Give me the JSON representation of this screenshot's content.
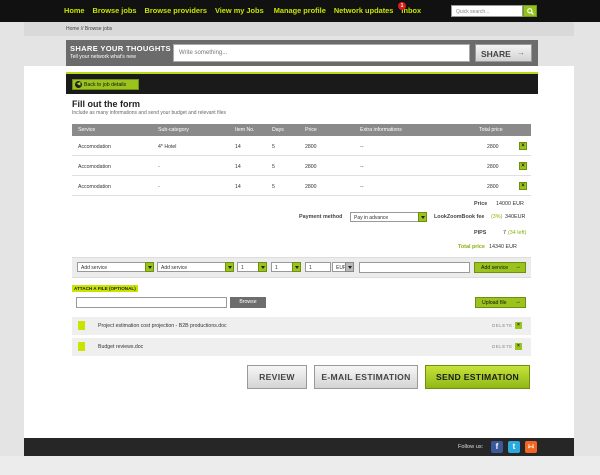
{
  "nav": {
    "items": [
      "Home",
      "Browse jobs",
      "Browse providers",
      "View my Jobs",
      "Manage profile",
      "Network updates",
      "Inbox"
    ],
    "inbox_badge": "1",
    "search_placeholder": "Quick search..."
  },
  "breadcrumb": "Home //  Browse jobs",
  "share": {
    "title": "SHARE YOUR THOUGHTS",
    "subtitle": "Tell your network what's new",
    "placeholder": "Write something...",
    "button": "SHARE"
  },
  "back_button": "Back to job details",
  "form": {
    "title": "Fill out the form",
    "subtitle": "Include as many informations and send your budget and relevant files"
  },
  "table": {
    "headers": [
      "Service",
      "Sub-category",
      "Item No.",
      "Days",
      "Price",
      "Extra informations",
      "Total price"
    ],
    "rows": [
      [
        "Accomodation",
        "4* Hotel",
        "14",
        "5",
        "2800",
        "--",
        "2800"
      ],
      [
        "Accomodation",
        "-",
        "14",
        "5",
        "2800",
        "--",
        "2800"
      ],
      [
        "Accomodation",
        "-",
        "14",
        "5",
        "2800",
        "--",
        "2800"
      ]
    ]
  },
  "summary": {
    "price_label": "Price",
    "price_value": "14000 EUR",
    "payment_label": "Payment method",
    "payment_value": "Pay in advance",
    "fee_label": "LookZoomBook fee",
    "fee_pct": "(3%)",
    "fee_value": "340EUR",
    "pips_label": "PIPS",
    "pips_value": "7",
    "pips_left": "(34 left)",
    "total_label": "Total price",
    "total_value": "14340 EUR"
  },
  "add_row": {
    "service1": "Add service",
    "service2": "Add service",
    "qty1": "1",
    "qty2": "1",
    "qty3": "1",
    "currency": "EUR",
    "button": "Add service"
  },
  "attach": {
    "label": "ATTACH A FILE (OPTIONAL)",
    "browse": "Browse",
    "upload": "Upload file",
    "files": [
      "Project estimation cost projection - B2B productions.doc",
      "Budget reviews.doc"
    ],
    "delete_label": "DELETE"
  },
  "actions": {
    "review": "REVIEW",
    "email": "E-MAIL ESTIMATION",
    "send": "SEND ESTIMATION"
  },
  "footer": {
    "follow": "Follow us:"
  },
  "colors": {
    "accent": "#9bc31e",
    "nav_text": "#c8e400",
    "dark": "#111111"
  }
}
